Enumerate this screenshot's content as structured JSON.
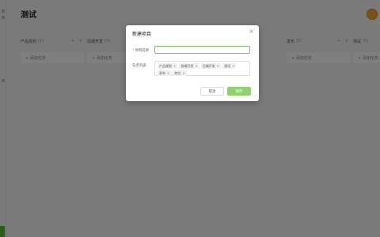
{
  "page": {
    "title": "测试"
  },
  "columns": [
    {
      "name": "产品规划",
      "count": "(1)",
      "tools": "+  ×",
      "add_label": "+ 添加任务"
    },
    {
      "name": "前端开发",
      "count": "(0)",
      "tools": "+  ×",
      "add_label": "+ 添加任务"
    },
    {
      "name": "",
      "count": "",
      "tools": "",
      "add_label": ""
    },
    {
      "name": "",
      "count": "",
      "tools": "",
      "add_label": ""
    },
    {
      "name": "发布",
      "count": "(0)",
      "tools": "+  ×",
      "add_label": "+ 添加任务"
    },
    {
      "name": "测试",
      "count": "(0)",
      "tools": "",
      "add_label": "+ 添加任务"
    }
  ],
  "modal": {
    "title": "新建项目",
    "close_glyph": "×",
    "name_label": "项目名称",
    "name_required": "*",
    "name_value": "",
    "name_placeholder": "|",
    "list_label": "任务列表",
    "tags": [
      "产品规划",
      "前端开发",
      "后端开发",
      "测试",
      "发布",
      "其它"
    ],
    "tag_remove": "×",
    "cancel_label": "取消",
    "save_label": "保存"
  },
  "colors": {
    "accent": "#8fd16b",
    "focus_border": "#7cc25a",
    "avatar": "#f2a531"
  }
}
